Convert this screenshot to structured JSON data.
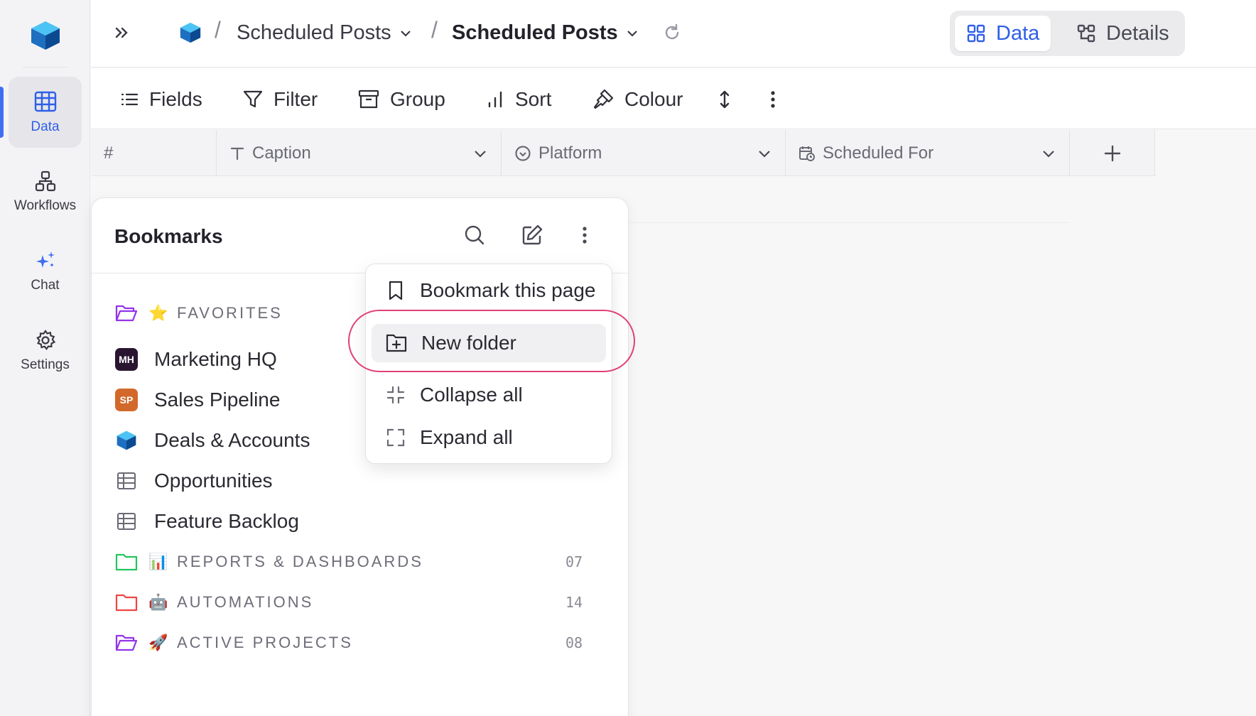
{
  "rail": {
    "items": [
      {
        "label": "Data",
        "icon": "table-icon",
        "active": true
      },
      {
        "label": "Workflows",
        "icon": "workflow-icon"
      },
      {
        "label": "Chat",
        "icon": "sparkle-icon"
      },
      {
        "label": "Settings",
        "icon": "gear-icon"
      }
    ]
  },
  "header": {
    "breadcrumb_1": "Scheduled Posts",
    "breadcrumb_2": "Scheduled Posts",
    "separator": "/",
    "view_data": "Data",
    "view_details": "Details"
  },
  "toolbar": {
    "fields": "Fields",
    "filter": "Filter",
    "group": "Group",
    "sort": "Sort",
    "colour": "Colour"
  },
  "grid": {
    "columns": [
      {
        "label": "#"
      },
      {
        "label": "Caption",
        "icon": "text-type-icon"
      },
      {
        "label": "Platform",
        "icon": "select-circle-icon"
      },
      {
        "label": "Scheduled For",
        "icon": "calendar-clock-icon"
      }
    ]
  },
  "bookmarks": {
    "title": "Bookmarks",
    "favorites": {
      "label": "FAVORITES",
      "emoji": "⭐"
    },
    "items": [
      {
        "label": "Marketing HQ",
        "badge": "MH",
        "badge_color": "#2a1530"
      },
      {
        "label": "Sales Pipeline",
        "badge": "SP",
        "badge_color": "#d2692a"
      },
      {
        "label": "Deals & Accounts"
      },
      {
        "label": "Opportunities"
      },
      {
        "label": "Feature Backlog"
      }
    ],
    "folders": [
      {
        "label": "REPORTS & DASHBOARDS",
        "emoji": "📊",
        "count": "07",
        "color": "#22c55e"
      },
      {
        "label": "AUTOMATIONS",
        "emoji": "🤖",
        "count": "14",
        "color": "#ef4444"
      },
      {
        "label": "ACTIVE PROJECTS",
        "emoji": "🚀",
        "count": "08",
        "color": "#9333ea"
      }
    ]
  },
  "menu": {
    "bookmark_page": "Bookmark this page",
    "new_folder": "New folder",
    "collapse_all": "Collapse all",
    "expand_all": "Expand all"
  },
  "colors": {
    "accent": "#2f5fe8",
    "highlight_ring": "#e0407a"
  }
}
